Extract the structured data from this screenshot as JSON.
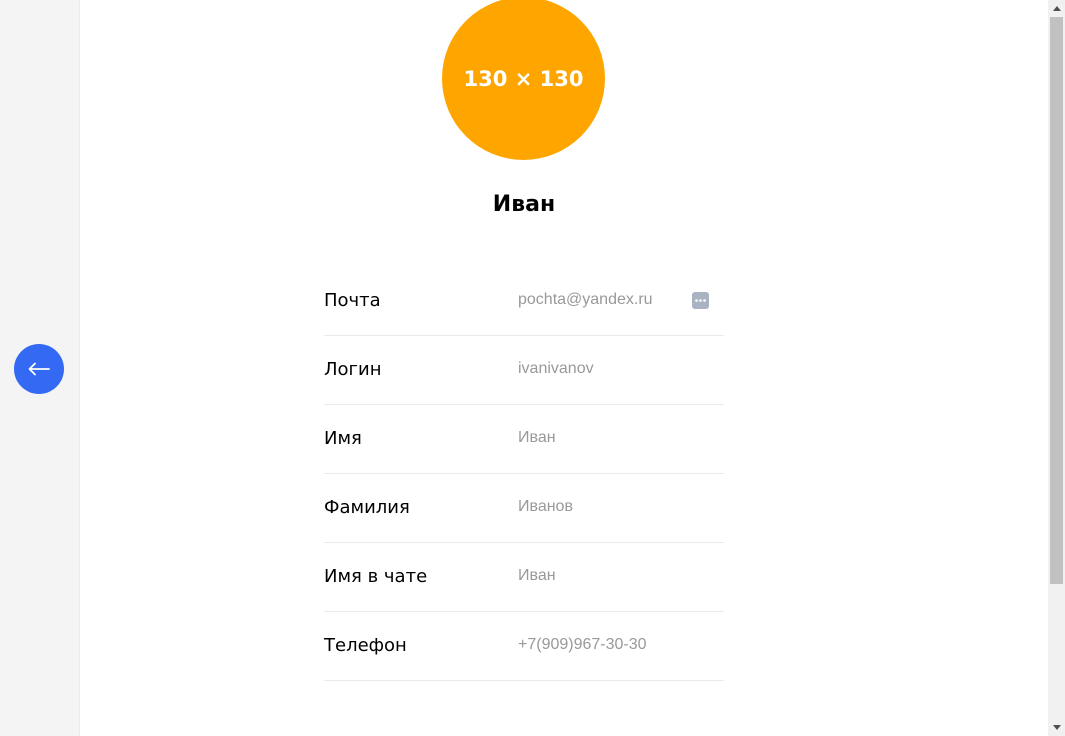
{
  "back_button": {
    "icon": "arrow-left-icon",
    "color": "#3369f3"
  },
  "avatar": {
    "placeholder_text": "130 × 130",
    "color": "#ffa500"
  },
  "profile": {
    "display_name": "Иван"
  },
  "fields": [
    {
      "label": "Почта",
      "value": "pochta@yandex.ru",
      "has_autofill_icon": true
    },
    {
      "label": "Логин",
      "value": "ivanivanov"
    },
    {
      "label": "Имя",
      "value": "Иван"
    },
    {
      "label": "Фамилия",
      "value": "Иванов"
    },
    {
      "label": "Имя в чате",
      "value": "Иван"
    },
    {
      "label": "Телефон",
      "value": "+7(909)967-30-30"
    }
  ],
  "colors": {
    "label_text": "#000000",
    "value_text": "#999999",
    "divider": "#eaeaea",
    "side_panel": "#f4f4f4"
  }
}
